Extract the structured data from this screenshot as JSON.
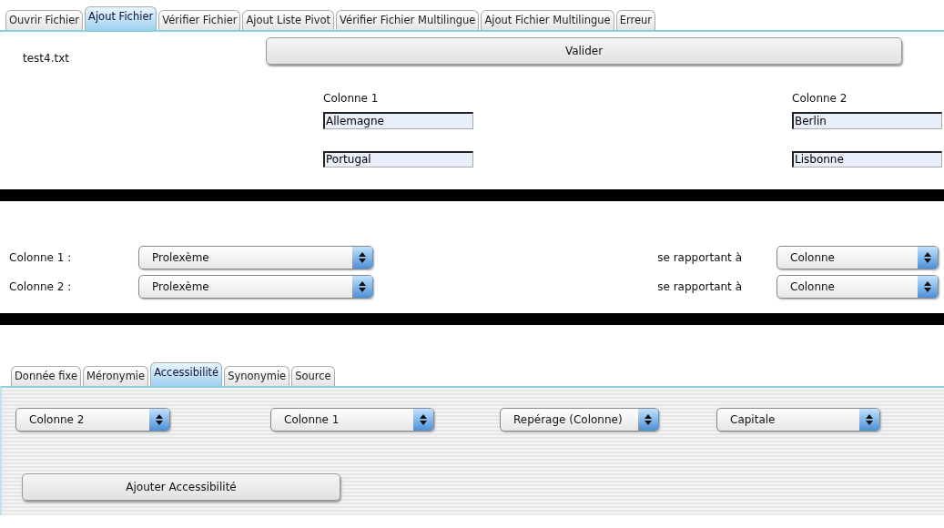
{
  "tabs": [
    {
      "label": "Ouvrir Fichier",
      "selected": false
    },
    {
      "label": "Ajout Fichier",
      "selected": true
    },
    {
      "label": "Vérifier Fichier",
      "selected": false
    },
    {
      "label": "Ajout Liste Pivot",
      "selected": false
    },
    {
      "label": "Vérifier Fichier Multilingue",
      "selected": false
    },
    {
      "label": "Ajout Fichier Multilingue",
      "selected": false
    },
    {
      "label": "Erreur",
      "selected": false
    }
  ],
  "file_name": "test4.txt",
  "validate_button": "Valider",
  "preview": {
    "columns": [
      {
        "heading": "Colonne 1",
        "values": [
          "Allemagne",
          "Portugal"
        ]
      },
      {
        "heading": "Colonne 2",
        "values": [
          "Berlin",
          "Lisbonne"
        ]
      }
    ]
  },
  "mapping": [
    {
      "label": "Colonne 1 :",
      "type": "Prolexème",
      "relation": "se rapportant à",
      "target": "Colonne"
    },
    {
      "label": "Colonne 2 :",
      "type": "Prolexème",
      "relation": "se rapportant à",
      "target": "Colonne"
    }
  ],
  "sub_tabs": [
    {
      "label": "Donnée fixe",
      "selected": false
    },
    {
      "label": "Méronymie",
      "selected": false
    },
    {
      "label": "Accessibilité",
      "selected": true
    },
    {
      "label": "Synonymie",
      "selected": false
    },
    {
      "label": "Source",
      "selected": false
    }
  ],
  "relation_selects": [
    "Colonne 2",
    "Colonne 1",
    "Repérage (Colonne)",
    "Capitale"
  ],
  "add_button": "Ajouter Accessibilité"
}
